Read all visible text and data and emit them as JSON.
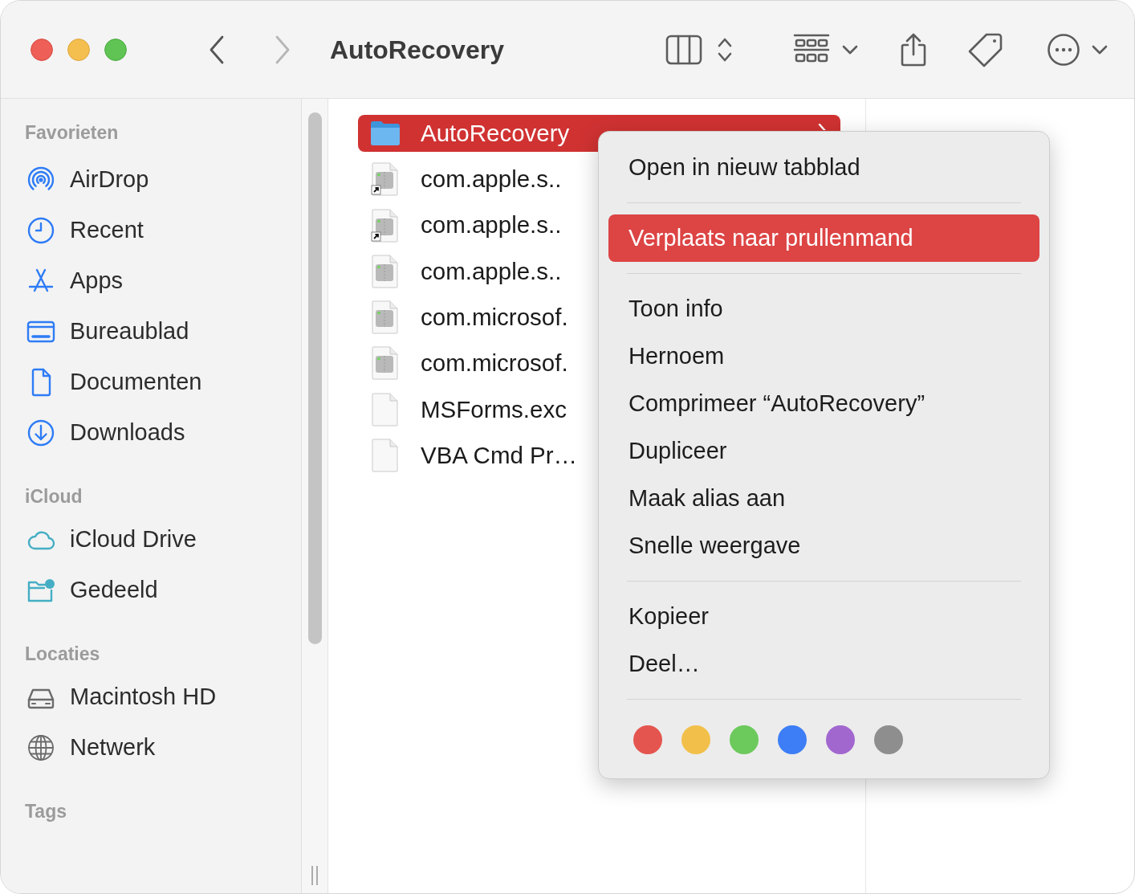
{
  "window": {
    "title": "AutoRecovery"
  },
  "toolbar": {
    "back": {
      "disabled": false
    },
    "forward": {
      "disabled": true
    }
  },
  "sidebar": {
    "sections": [
      {
        "heading": "Favorieten",
        "items": [
          {
            "label": "AirDrop",
            "selected": false
          },
          {
            "label": "Recent",
            "selected": false
          },
          {
            "label": "Apps",
            "selected": false
          },
          {
            "label": "Bureaublad",
            "selected": false
          },
          {
            "label": "Documenten",
            "selected": false
          },
          {
            "label": "Downloads",
            "selected": false
          }
        ]
      },
      {
        "heading": "iCloud",
        "items": [
          {
            "label": "iCloud Drive",
            "selected": false
          },
          {
            "label": "Gedeeld",
            "selected": false
          }
        ]
      },
      {
        "heading": "Locaties",
        "items": [
          {
            "label": "Macintosh HD",
            "selected": false
          },
          {
            "label": "Netwerk",
            "selected": false
          }
        ]
      },
      {
        "heading": "Tags"
      }
    ]
  },
  "files": {
    "items": [
      {
        "name": "AutoRecovery",
        "kind": "folder",
        "selected": true
      },
      {
        "name": "com.apple.s..",
        "kind": "alias",
        "selected": false
      },
      {
        "name": "com.apple.s..",
        "kind": "alias",
        "selected": false
      },
      {
        "name": "com.apple.s..",
        "kind": "archive",
        "selected": false
      },
      {
        "name": "com.microsof.",
        "kind": "archive",
        "selected": false
      },
      {
        "name": "com.microsof.",
        "kind": "archive",
        "selected": false
      },
      {
        "name": "MSForms.exc",
        "kind": "document",
        "selected": false
      },
      {
        "name": "VBA Cmd Pr…",
        "kind": "document",
        "selected": false
      }
    ]
  },
  "context_menu": {
    "sections": [
      {
        "items": [
          {
            "label": "Open in nieuw tabblad",
            "selected": false
          }
        ]
      },
      {
        "items": [
          {
            "label": "Verplaats naar prullenmand",
            "selected": true
          }
        ]
      },
      {
        "items": [
          {
            "label": "Toon info",
            "selected": false
          },
          {
            "label": "Hernoem",
            "selected": false
          },
          {
            "label": "Comprimeer “AutoRecovery”",
            "selected": false
          },
          {
            "label": "Dupliceer",
            "selected": false
          },
          {
            "label": "Maak alias aan",
            "selected": false
          },
          {
            "label": "Snelle weergave",
            "selected": false
          }
        ]
      },
      {
        "items": [
          {
            "label": "Kopieer",
            "selected": false
          },
          {
            "label": "Deel…",
            "selected": false
          }
        ]
      }
    ],
    "tag_colors": [
      {
        "color": "#e5554f"
      },
      {
        "color": "#f2c04a"
      },
      {
        "color": "#6cc95c"
      },
      {
        "color": "#3d7ef6"
      },
      {
        "color": "#a267cf"
      },
      {
        "color": "#8e8e8e"
      }
    ]
  }
}
